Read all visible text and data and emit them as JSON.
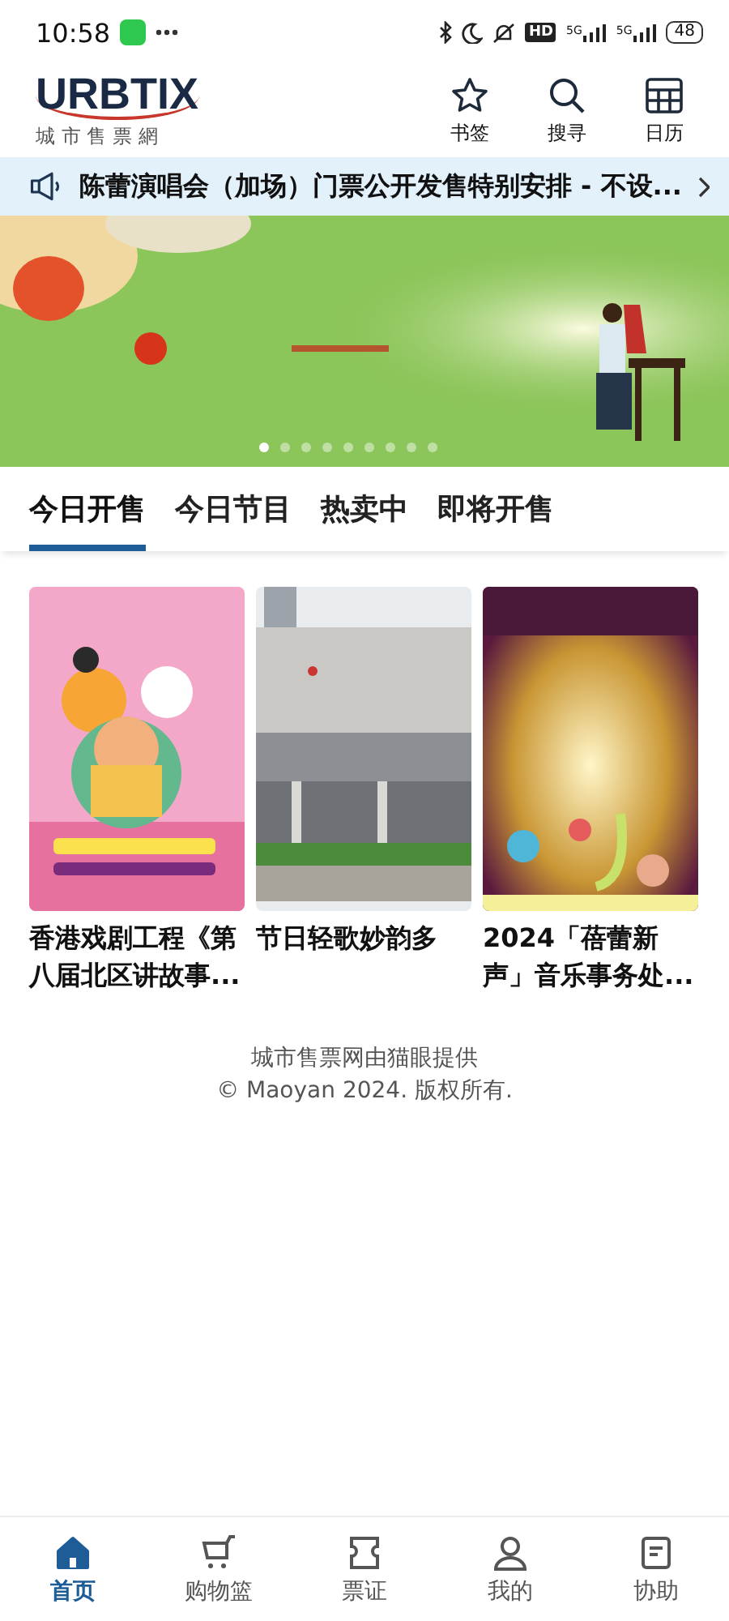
{
  "status_bar": {
    "time": "10:58",
    "hd": "HD",
    "network_1": "5G",
    "network_2": "5G",
    "battery": "48"
  },
  "header": {
    "logo": "URBTIX",
    "logo_subtitle": "城 市 售 票 網",
    "actions": [
      {
        "label": "书签",
        "kind": "star"
      },
      {
        "label": "搜寻",
        "kind": "search"
      },
      {
        "label": "日历",
        "kind": "calendar"
      }
    ]
  },
  "notice": {
    "text": "陈蕾演唱会（加场）门票公开发售特别安排 - 不设..."
  },
  "banner": {
    "kind": "picture",
    "dots": [
      {
        "selected": true
      },
      {
        "selected": false
      },
      {
        "selected": false
      },
      {
        "selected": false
      },
      {
        "selected": false
      },
      {
        "selected": false
      },
      {
        "selected": false
      },
      {
        "selected": false
      },
      {
        "selected": false
      }
    ]
  },
  "tabs": [
    {
      "label": "今日开售",
      "selected": true
    },
    {
      "label": "今日节目",
      "selected": false
    },
    {
      "label": "热卖中",
      "selected": false
    },
    {
      "label": "即将开售",
      "selected": false
    }
  ],
  "events": [
    {
      "title": "香港戏剧工程《第八届北区讲故事...",
      "kind": "poster"
    },
    {
      "title": "节日轻歌妙韵多",
      "kind": "building"
    },
    {
      "title": "2024「蓓蕾新声」音乐事务处...",
      "kind": "concert"
    }
  ],
  "footer": {
    "line_1": "城市售票网由猫眼提供",
    "line_2": "© Maoyan 2024. 版权所有."
  },
  "bottom_nav": [
    {
      "label": "首页",
      "kind": "home",
      "selected": true
    },
    {
      "label": "购物篮",
      "kind": "cart",
      "selected": false
    },
    {
      "label": "票证",
      "kind": "ticket",
      "selected": false
    },
    {
      "label": "我的",
      "kind": "user",
      "selected": false
    },
    {
      "label": "协助",
      "kind": "help",
      "selected": false
    }
  ]
}
